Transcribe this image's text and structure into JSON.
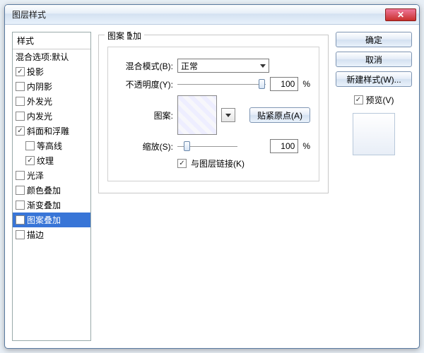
{
  "window": {
    "title": "图层样式"
  },
  "styles": {
    "header": "样式",
    "blendOptions": "混合选项:默认",
    "items": [
      {
        "label": "投影",
        "checked": true,
        "indent": false
      },
      {
        "label": "内阴影",
        "checked": false,
        "indent": false
      },
      {
        "label": "外发光",
        "checked": false,
        "indent": false
      },
      {
        "label": "内发光",
        "checked": false,
        "indent": false
      },
      {
        "label": "斜面和浮雕",
        "checked": true,
        "indent": false
      },
      {
        "label": "等高线",
        "checked": false,
        "indent": true
      },
      {
        "label": "纹理",
        "checked": true,
        "indent": true
      },
      {
        "label": "光泽",
        "checked": false,
        "indent": false
      },
      {
        "label": "颜色叠加",
        "checked": false,
        "indent": false
      },
      {
        "label": "渐变叠加",
        "checked": false,
        "indent": false
      },
      {
        "label": "图案叠加",
        "checked": true,
        "indent": false,
        "selected": true
      },
      {
        "label": "描边",
        "checked": false,
        "indent": false
      }
    ]
  },
  "panel": {
    "title": "图案叠加",
    "group": "图案",
    "blendModeLabel": "混合模式(B):",
    "blendModeValue": "正常",
    "opacityLabel": "不透明度(Y):",
    "opacityValue": "100",
    "percent": "%",
    "patternLabel": "图案:",
    "snapLabel": "贴紧原点(A)",
    "scaleLabel": "缩放(S):",
    "scaleValue": "100",
    "linkLabel": "与图层链接(K)"
  },
  "actions": {
    "ok": "确定",
    "cancel": "取消",
    "newStyle": "新建样式(W)...",
    "previewLabel": "预览(V)"
  }
}
